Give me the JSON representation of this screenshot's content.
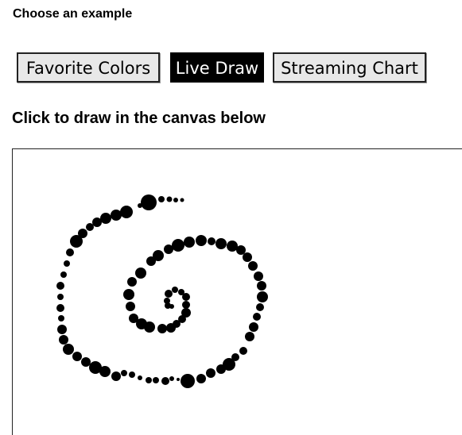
{
  "header": {
    "title": "Choose an example"
  },
  "tabs": [
    {
      "label": "Favorite Colors",
      "active": false
    },
    {
      "label": "Live Draw",
      "active": true
    },
    {
      "label": "Streaming Chart",
      "active": false
    }
  ],
  "live_draw": {
    "instruction": "Click to draw in the canvas below",
    "stroke_color": "#000000"
  },
  "colors": {
    "active_tab_bg": "#000000",
    "active_tab_text": "#ffffff",
    "inactive_tab_bg": "#e8e8e8"
  }
}
